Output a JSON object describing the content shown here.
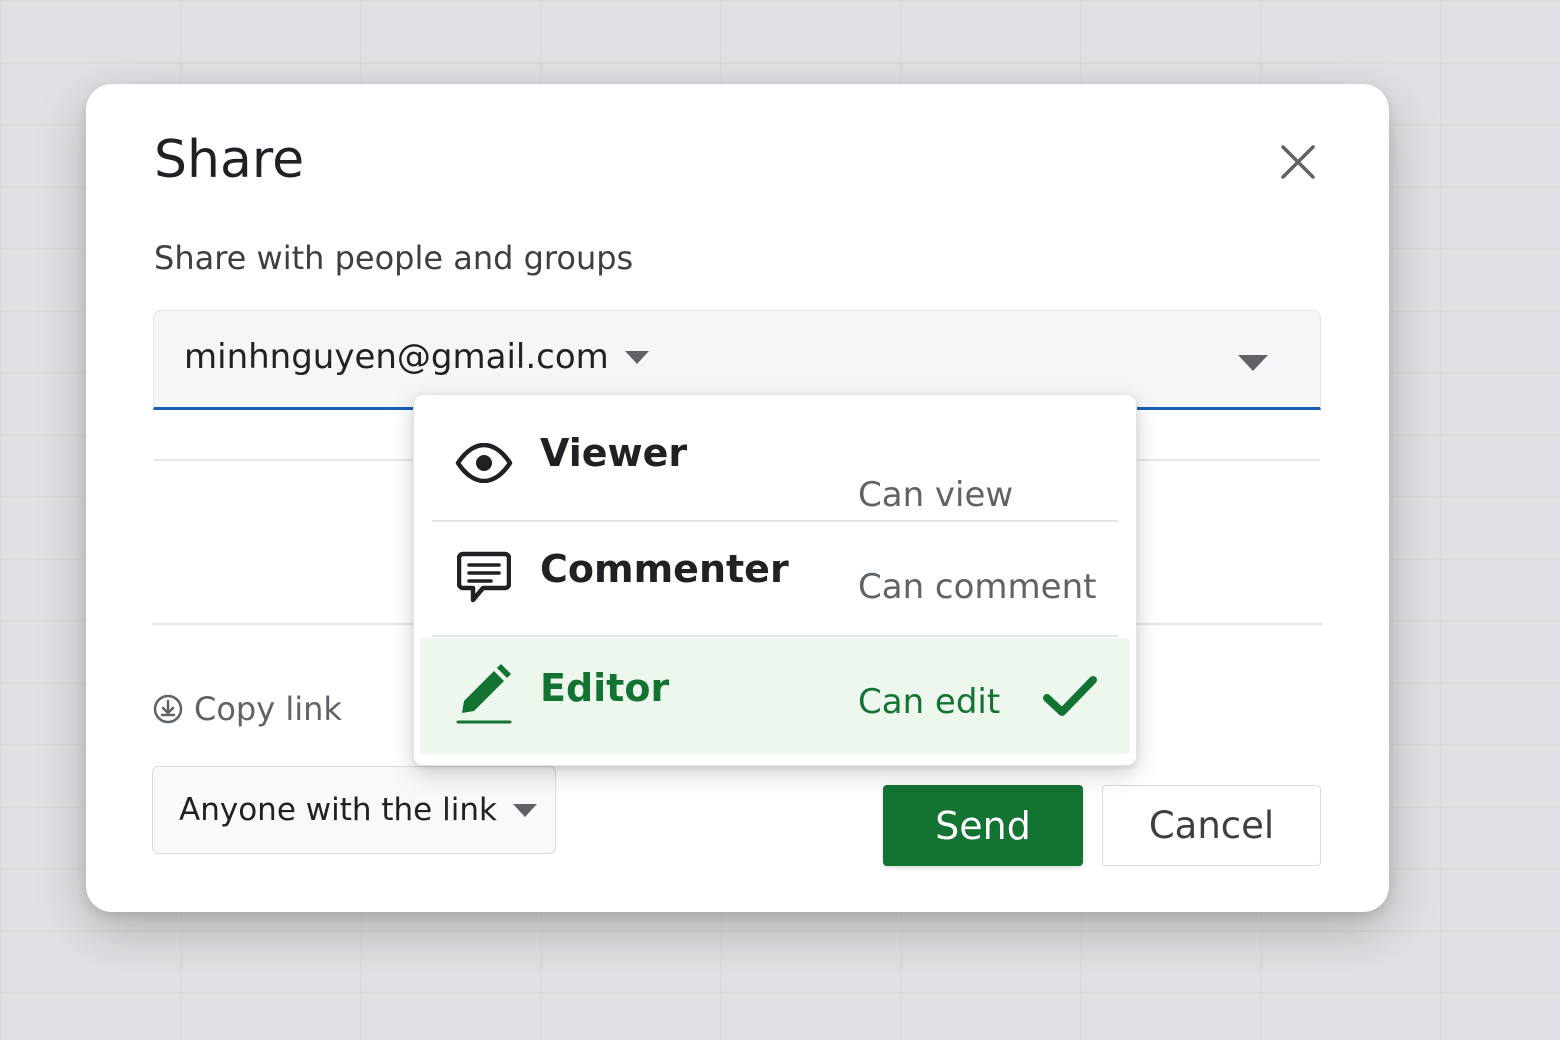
{
  "dialog": {
    "title": "Share",
    "subtitle": "Share with people and groups"
  },
  "recipient": {
    "email": "minhnguyen@gmail.com"
  },
  "role_menu": {
    "items": [
      {
        "role": "Viewer",
        "description": "Can view",
        "icon": "eye-icon",
        "selected": false
      },
      {
        "role": "Commenter",
        "description": "Can comment",
        "icon": "comment-icon",
        "selected": false
      },
      {
        "role": "Editor",
        "description": "Can edit",
        "icon": "pencil-icon",
        "selected": true
      }
    ]
  },
  "footer": {
    "copy_link_label": "Copy link",
    "access_label": "Anyone with the link",
    "send_label": "Send",
    "cancel_label": "Cancel"
  },
  "colors": {
    "accent_green": "#137333",
    "field_underline": "#1a5fb4",
    "selected_bg": "#eef7ee"
  }
}
